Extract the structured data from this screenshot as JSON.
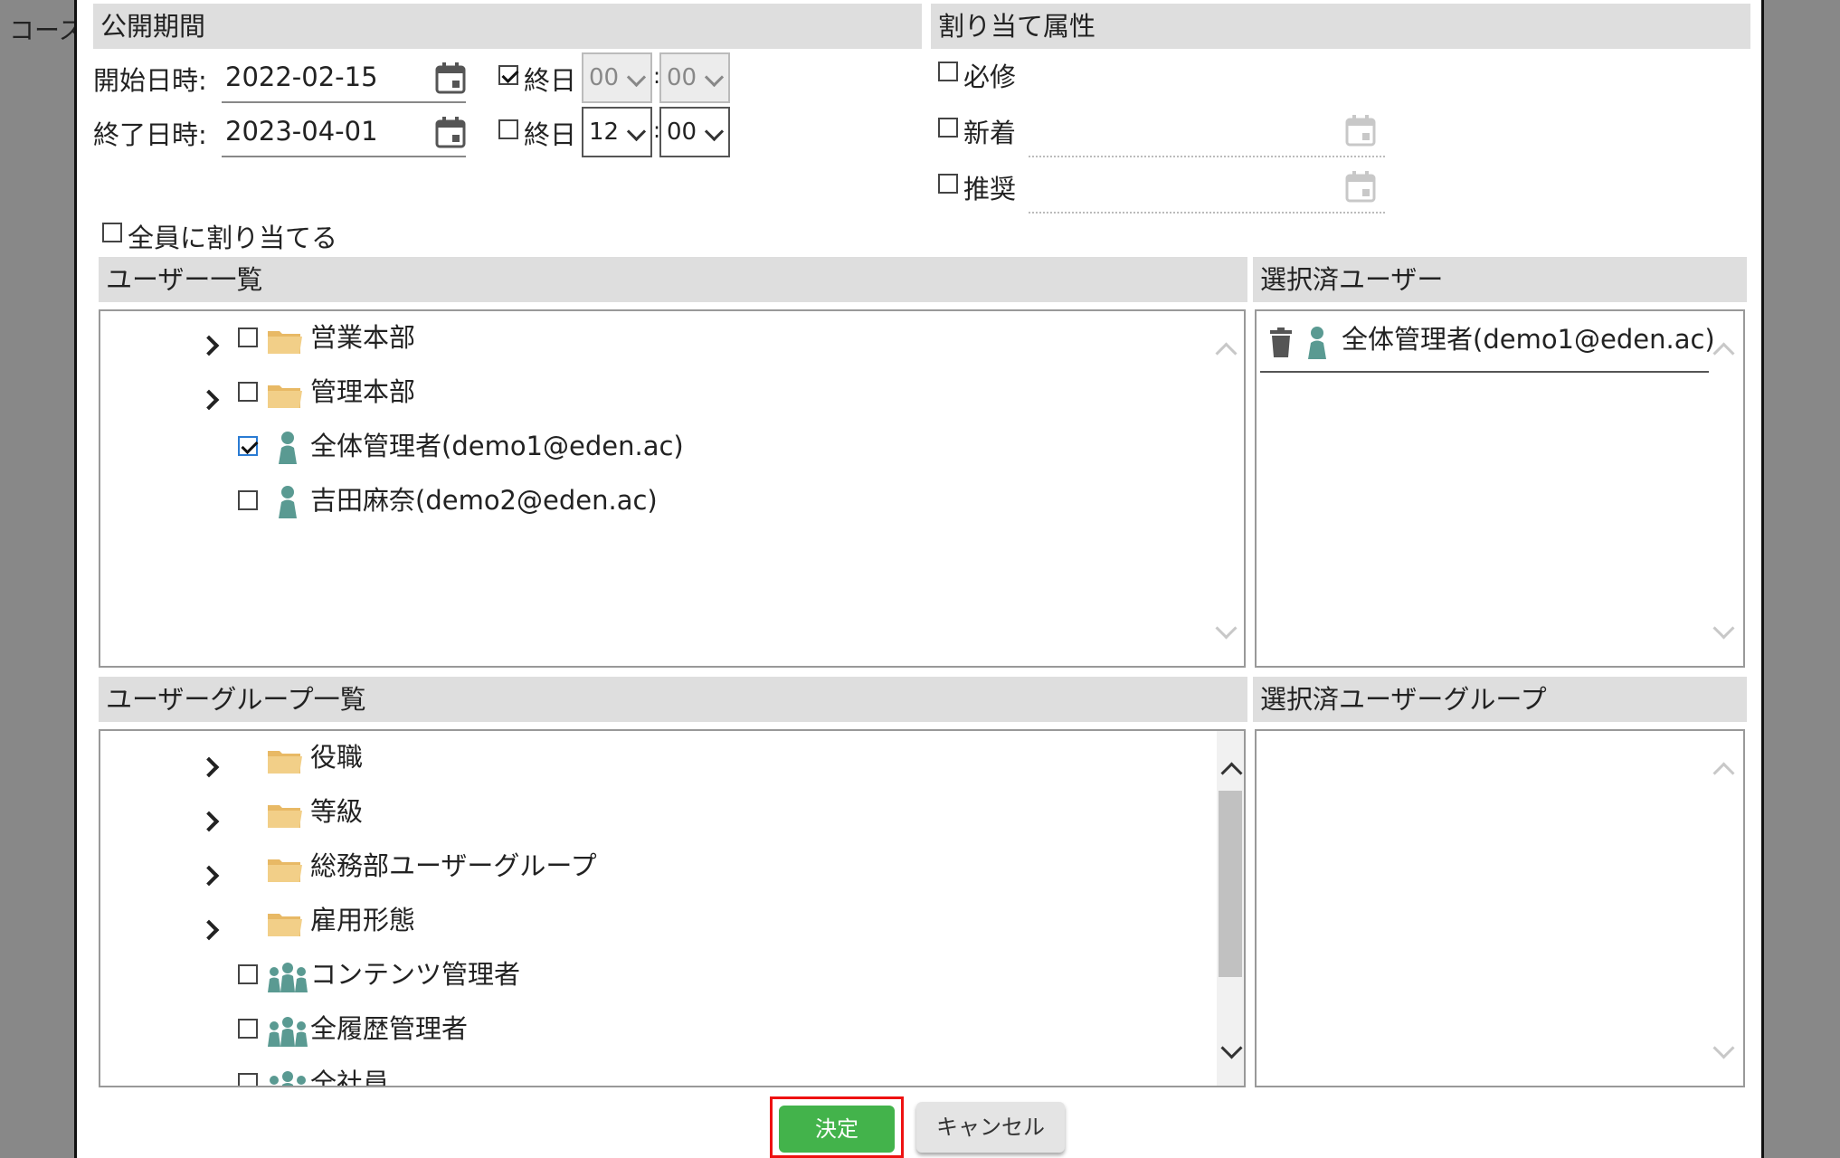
{
  "background": {
    "title_fragment": "コース"
  },
  "period": {
    "header": "公開期間",
    "start_label": "開始日時:",
    "start_date": "2022-02-15",
    "start_allday_label": "終日",
    "start_allday_checked": true,
    "start_hour": "00",
    "start_minute": "00",
    "end_label": "終了日時:",
    "end_date": "2023-04-01",
    "end_allday_label": "終日",
    "end_allday_checked": false,
    "end_hour": "12",
    "end_minute": "00",
    "time_separator": ":"
  },
  "attributes": {
    "header": "割り当て属性",
    "required_label": "必修",
    "new_label": "新着",
    "recommended_label": "推奨"
  },
  "assign_all_label": "全員に割り当てる",
  "user_list": {
    "header": "ユーザー一覧",
    "items": [
      {
        "label": "営業本部",
        "type": "folder",
        "checked": false
      },
      {
        "label": "管理本部",
        "type": "folder",
        "checked": false
      },
      {
        "label": "全体管理者(demo1@eden.ac)",
        "type": "user",
        "checked": true
      },
      {
        "label": "吉田麻奈(demo2@eden.ac)",
        "type": "user",
        "checked": false
      }
    ]
  },
  "selected_users": {
    "header": "選択済ユーザー",
    "items": [
      {
        "label": "全体管理者(demo1@eden.ac)"
      }
    ]
  },
  "group_list": {
    "header": "ユーザーグループ一覧",
    "items": [
      {
        "label": "役職",
        "type": "folder"
      },
      {
        "label": "等級",
        "type": "folder"
      },
      {
        "label": "総務部ユーザーグループ",
        "type": "folder"
      },
      {
        "label": "雇用形態",
        "type": "folder"
      },
      {
        "label": "コンテンツ管理者",
        "type": "group",
        "checked": false
      },
      {
        "label": "全履歴管理者",
        "type": "group",
        "checked": false
      },
      {
        "label": "全社員",
        "type": "group",
        "checked": false
      }
    ]
  },
  "selected_groups": {
    "header": "選択済ユーザーグループ"
  },
  "buttons": {
    "ok": "決定",
    "cancel": "キャンセル"
  },
  "colors": {
    "ok_green": "#43b34b",
    "folder": "#e8b965",
    "user": "#5a9a92",
    "highlight": "#e11111"
  }
}
